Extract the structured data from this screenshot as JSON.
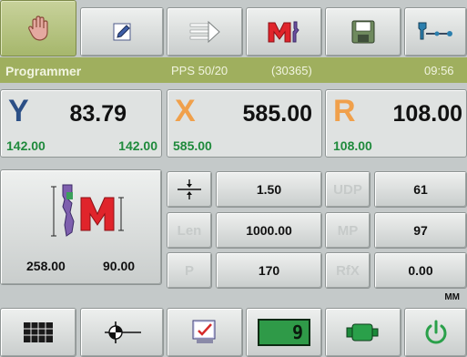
{
  "toolbar_top": {
    "icons": [
      "hand-icon",
      "pencil-icon",
      "arrow-right-icon",
      "bend-tool-icon",
      "save-icon",
      "tool-probe-icon"
    ]
  },
  "status": {
    "mode": "Programmer",
    "program": "PPS 50/20",
    "program_id": "(30365)",
    "time": "09:56"
  },
  "axes": {
    "y": {
      "letter": "Y",
      "value": "83.79",
      "sub_left": "142.00",
      "sub_right": "142.00"
    },
    "x": {
      "letter": "X",
      "value": "585.00",
      "sub": "585.00"
    },
    "r": {
      "letter": "R",
      "value": "108.00",
      "sub": "108.00"
    }
  },
  "tool_panel": {
    "left_value": "258.00",
    "right_value": "90.00"
  },
  "params": {
    "thickness": {
      "value": "1.50"
    },
    "len": {
      "label": "Len",
      "value": "1000.00"
    },
    "p": {
      "label": "P",
      "value": "170"
    },
    "udp": {
      "label": "UDP",
      "value": "61"
    },
    "mp": {
      "label": "MP",
      "value": "97"
    },
    "rx": {
      "label": "RfX",
      "value": "0.00"
    }
  },
  "units": "MM",
  "toolbar_bottom": {
    "counter": "9",
    "icons": [
      "table-icon",
      "axis-target-icon",
      "checklist-icon",
      "counter-display",
      "motor-icon",
      "power-icon"
    ]
  },
  "colors": {
    "status_bar": "#9faf5e",
    "y_axis": "#2b4f86",
    "x_axis": "#f0a04b",
    "r_axis": "#f0a04b",
    "green_values": "#1f8a3c",
    "counter_bg": "#2f9a48"
  }
}
